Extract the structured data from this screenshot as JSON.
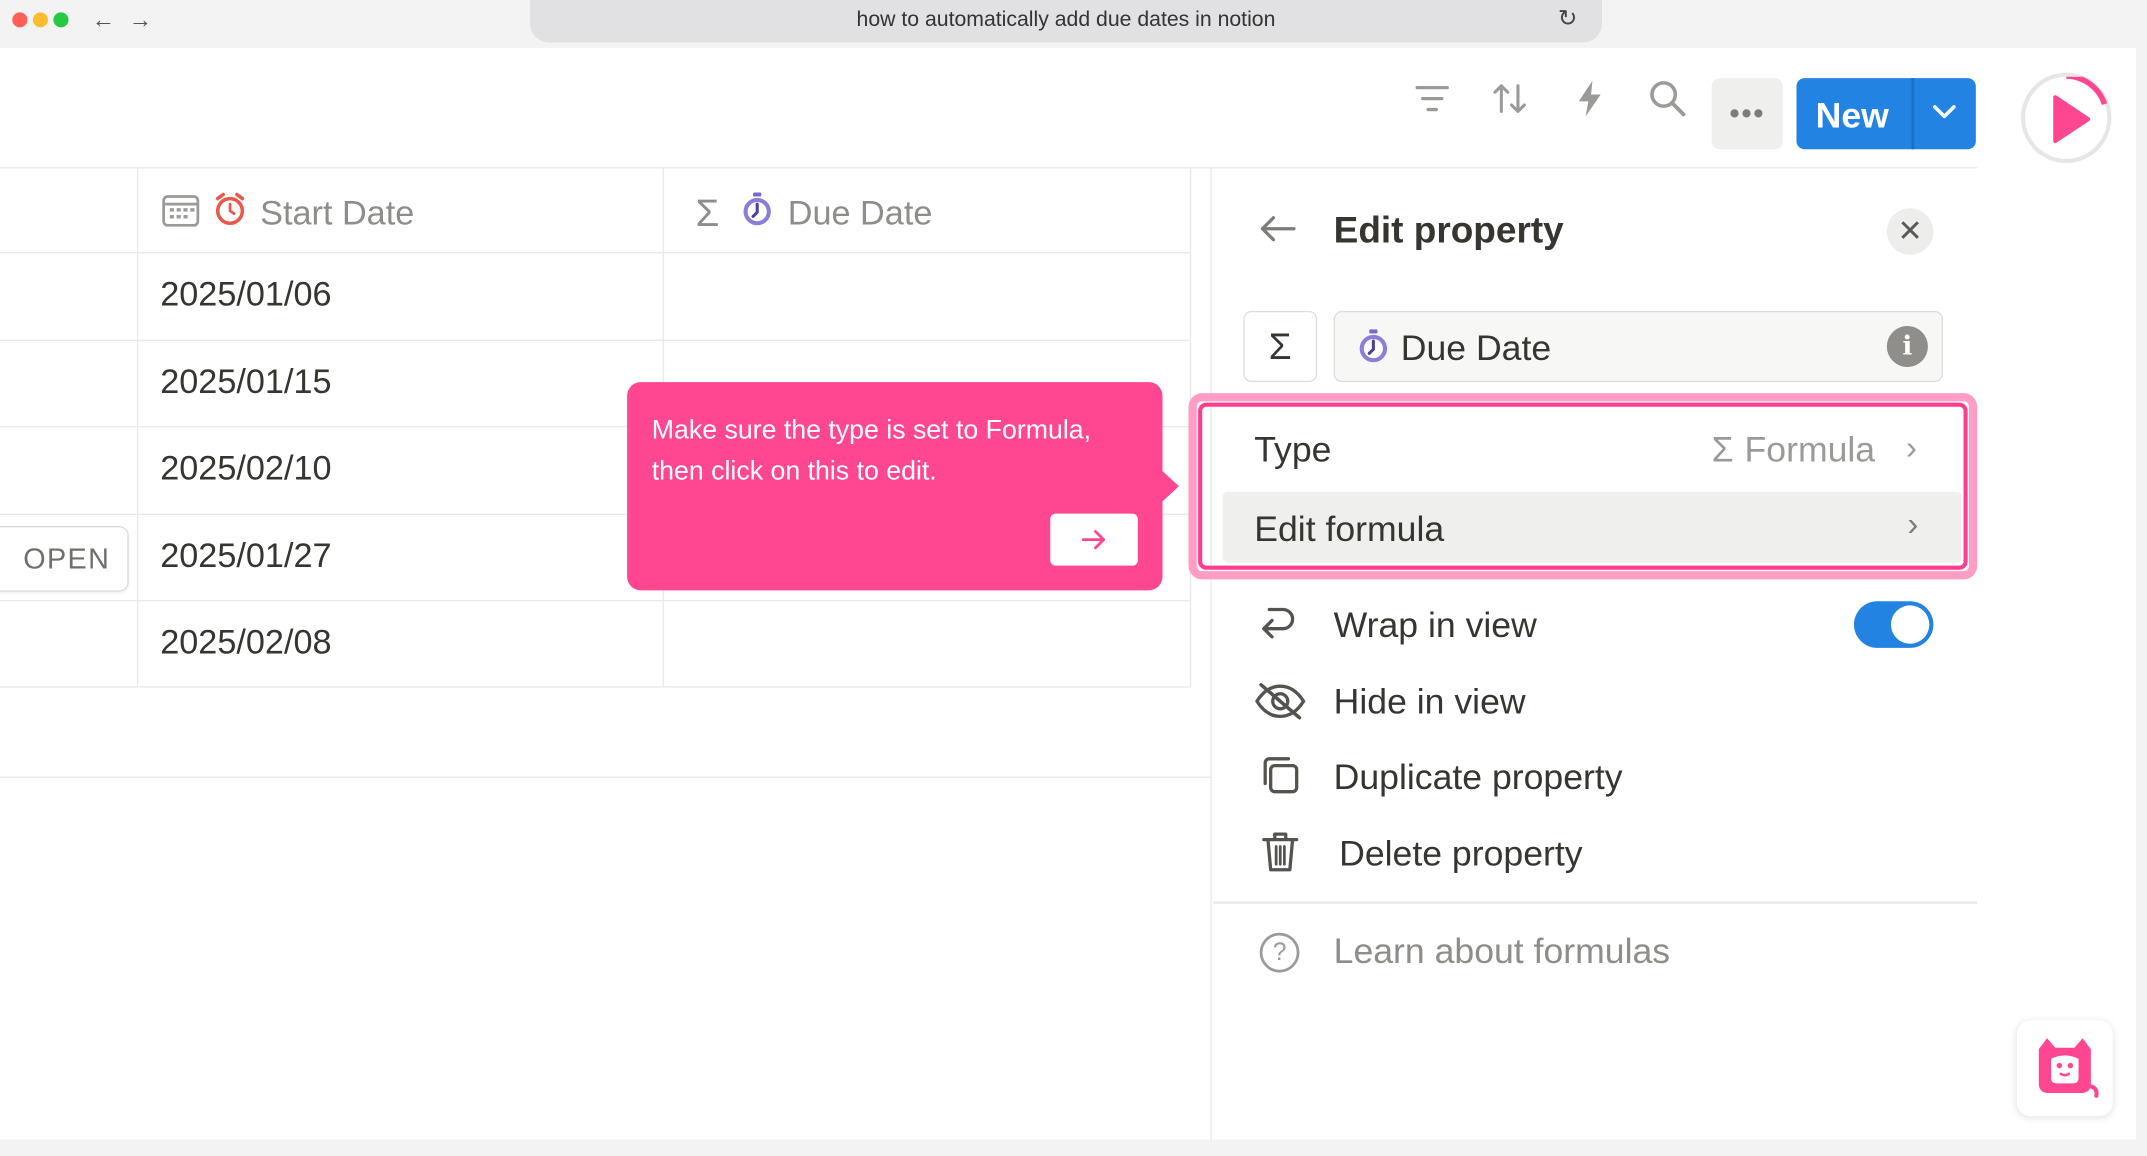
{
  "browser": {
    "url": "how to automatically add due dates in notion",
    "back_icon": "arrow-left-icon",
    "forward_icon": "arrow-right-icon",
    "reload_icon": "reload-icon",
    "traffic_lights": [
      "#ff5f57",
      "#febc2e",
      "#28c840"
    ]
  },
  "toolbar": {
    "icons": [
      "filter-icon",
      "sort-icon",
      "automation-bolt-icon",
      "search-icon"
    ],
    "more_label": "•••",
    "new_label": "New",
    "accent": "#2383e2"
  },
  "table": {
    "columns": [
      {
        "icon": "calendar-alarm-icon",
        "label": "Start Date"
      },
      {
        "icon": "sigma-watch-icon",
        "label": "Due Date"
      }
    ],
    "rows": [
      {
        "start_date": "2025/01/06",
        "due_date": ""
      },
      {
        "start_date": "2025/01/15",
        "due_date": ""
      },
      {
        "start_date": "2025/02/10",
        "due_date": ""
      },
      {
        "start_date": "2025/01/27",
        "due_date": ""
      },
      {
        "start_date": "2025/02/08",
        "due_date": ""
      }
    ],
    "open_label": "OPEN"
  },
  "tooltip": {
    "text": "Make sure the type is set to Formula, then click on this to edit.",
    "next_icon": "arrow-right-icon",
    "color": "#ff4691"
  },
  "panel": {
    "title": "Edit property",
    "property_icon": "Σ",
    "property_name": "Due Date",
    "type_label": "Type",
    "type_value": "Formula",
    "edit_formula_label": "Edit formula",
    "wrap_label": "Wrap in view",
    "wrap_enabled": true,
    "hide_label": "Hide in view",
    "duplicate_label": "Duplicate property",
    "delete_label": "Delete property",
    "learn_label": "Learn about formulas",
    "highlight_color": "#ff3d8e"
  }
}
